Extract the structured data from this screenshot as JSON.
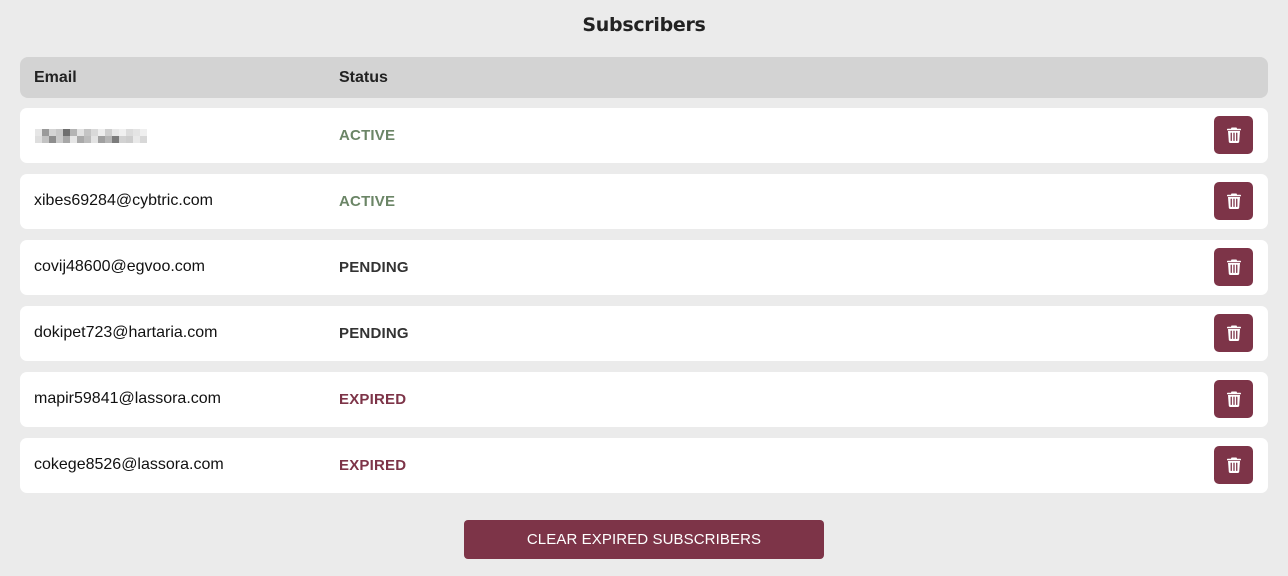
{
  "page": {
    "title": "Subscribers"
  },
  "table": {
    "headers": {
      "email": "Email",
      "status": "Status"
    },
    "rows": [
      {
        "email": "",
        "email_redacted": true,
        "status": "ACTIVE",
        "status_kind": "active"
      },
      {
        "email": "xibes69284@cybtric.com",
        "status": "ACTIVE",
        "status_kind": "active"
      },
      {
        "email": "covij48600@egvoo.com",
        "status": "PENDING",
        "status_kind": "pending"
      },
      {
        "email": "dokipet723@hartaria.com",
        "status": "PENDING",
        "status_kind": "pending"
      },
      {
        "email": "mapir59841@lassora.com",
        "status": "EXPIRED",
        "status_kind": "expired"
      },
      {
        "email": "cokege8526@lassora.com",
        "status": "EXPIRED",
        "status_kind": "expired"
      }
    ],
    "row_action_icon": "trash-icon"
  },
  "actions": {
    "clear_expired_label": "CLEAR EXPIRED SUBSCRIBERS"
  },
  "colors": {
    "accent": "#7d3448",
    "active": "#6b8566",
    "pending": "#333333",
    "expired": "#7d3448",
    "background": "#ebebeb",
    "header_bg": "#d3d3d3"
  }
}
